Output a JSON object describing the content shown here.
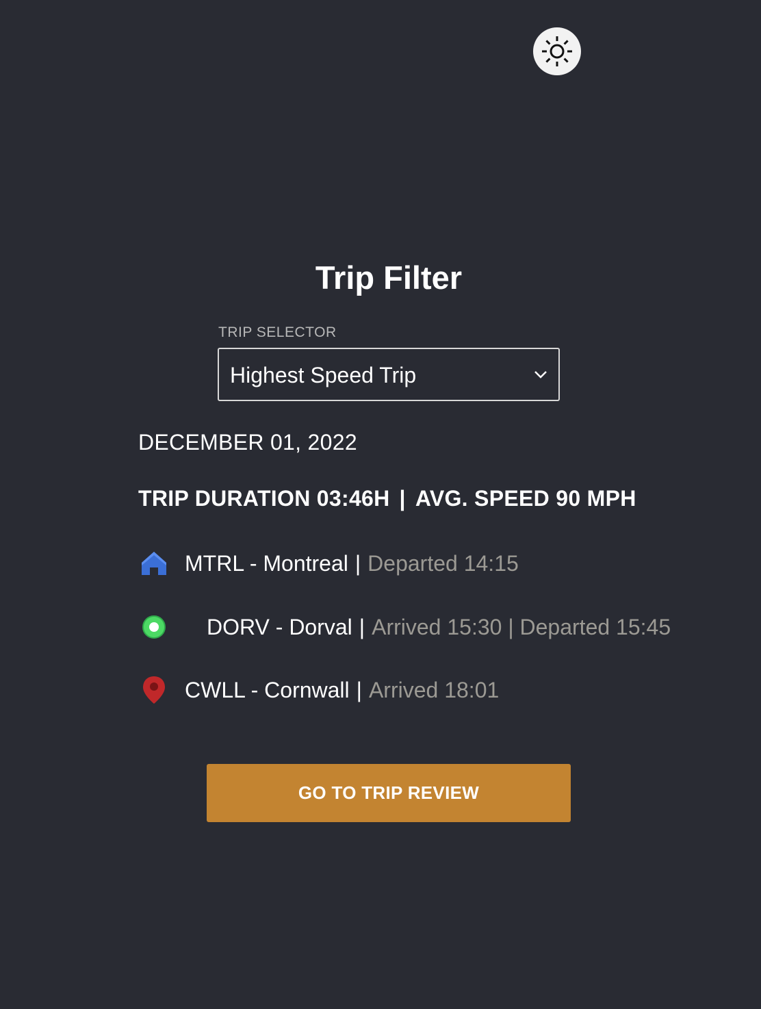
{
  "theme_toggle": {
    "icon": "sun-icon"
  },
  "title": "Trip Filter",
  "trip_selector": {
    "label": "TRIP SELECTOR",
    "value": "Highest Speed Trip",
    "icon": "chevron-down-icon"
  },
  "trip": {
    "date": "DECEMBER 01, 2022",
    "duration": "TRIP DURATION 03:46H",
    "separator": "|",
    "avg_speed": "AVG. SPEED 90 MPH"
  },
  "stops": [
    {
      "icon": "home-icon",
      "icon_color": "#3b6fd6",
      "name": "MTRL - Montreal",
      "separator": "|",
      "meta": "Departed 14:15"
    },
    {
      "icon": "green-dot-icon",
      "icon_color": "#4cd964",
      "name": "DORV - Dorval",
      "separator": "|",
      "meta": "Arrived 15:30 | Departed 15:45"
    },
    {
      "icon": "map-pin-icon",
      "icon_color": "#c0282a",
      "name": "CWLL - Cornwall",
      "separator": "|",
      "meta": "Arrived 18:01"
    }
  ],
  "cta": {
    "label": "GO TO TRIP REVIEW",
    "color": "#c38431"
  },
  "colors": {
    "background": "#292b33",
    "muted_text": "#9c9a94"
  }
}
